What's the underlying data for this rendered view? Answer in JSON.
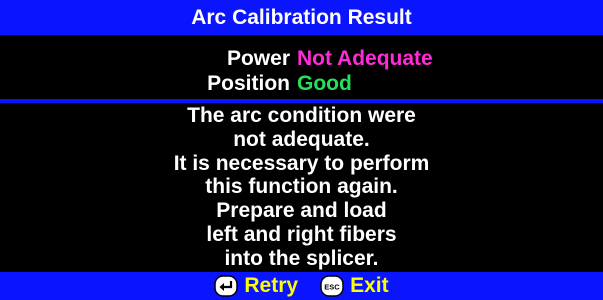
{
  "dialog": {
    "title": "Arc Calibration Result"
  },
  "results": {
    "power_label": "Power",
    "power_value": "Not Adequate",
    "position_label": "Position",
    "position_value": "Good"
  },
  "message_lines": [
    "The arc condition were",
    "not adequate.",
    "It is necessary to perform",
    "this function again.",
    "Prepare and load",
    "left and right fibers",
    "into the splicer."
  ],
  "footer": {
    "retry_label": "Retry",
    "retry_icon": "enter-key-icon",
    "exit_label": "Exit",
    "exit_icon": "esc-key-icon",
    "exit_icon_text": "ESC"
  },
  "colors": {
    "bar_blue": "#0a14ff",
    "background": "#000000",
    "text": "#ffffff",
    "not_adequate": "#ff2bd6",
    "good": "#24e05a",
    "softkey_label": "#fbff00"
  }
}
